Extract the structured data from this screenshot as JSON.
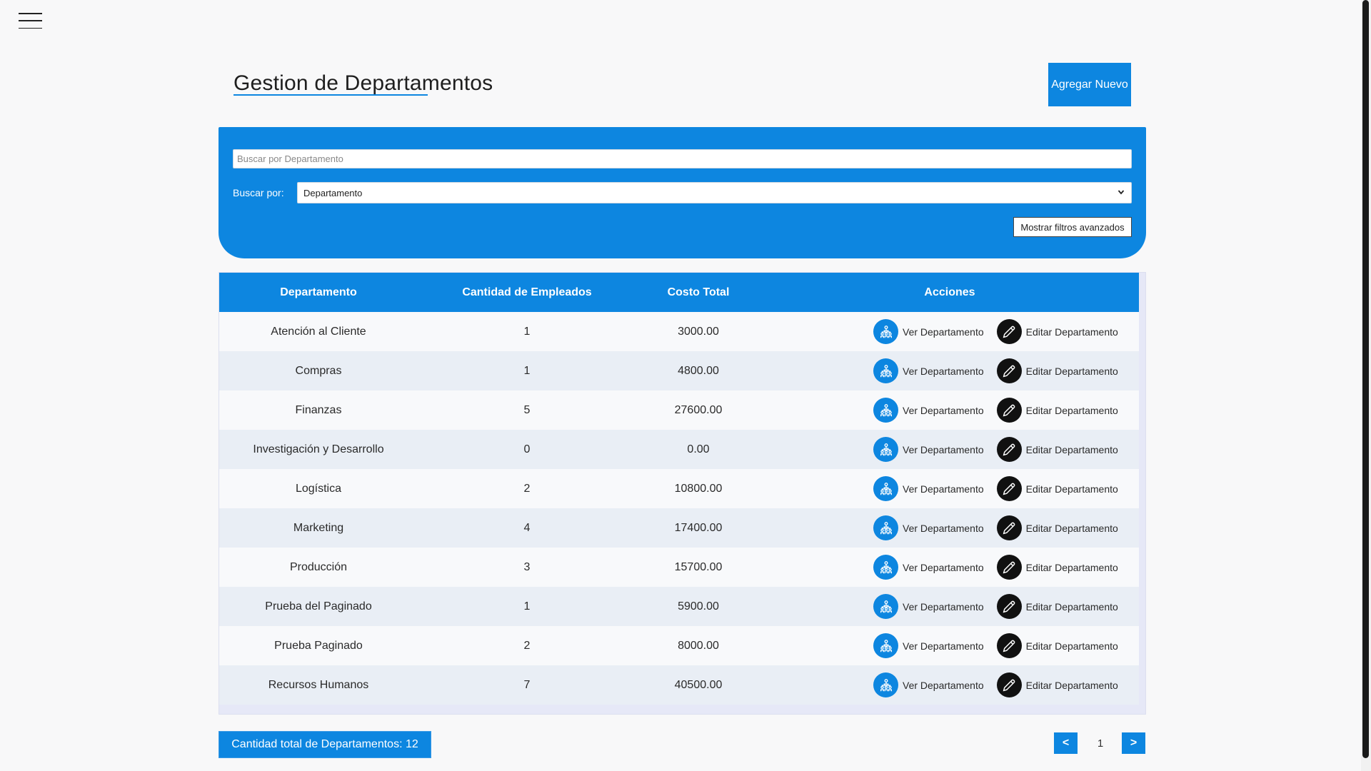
{
  "header": {
    "menu_icon": "hamburger-menu-icon",
    "title": "Gestion de Departamentos",
    "add_button": "Agregar Nuevo"
  },
  "search": {
    "placeholder": "Buscar por Departamento",
    "value": "",
    "search_by_label": "Buscar por:",
    "search_by_selected": "Departamento",
    "advanced_filters_button": "Mostrar filtros avanzados"
  },
  "table": {
    "columns": [
      "Departamento",
      "Cantidad de Empleados",
      "Costo Total",
      "Acciones"
    ],
    "view_label": "Ver Departamento",
    "edit_label": "Editar Departamento",
    "view_icon": "org-chart-icon",
    "edit_icon": "pencil-icon",
    "rows": [
      {
        "department": "Atención al Cliente",
        "employees": "1",
        "cost": "3000.00"
      },
      {
        "department": "Compras",
        "employees": "1",
        "cost": "4800.00"
      },
      {
        "department": "Finanzas",
        "employees": "5",
        "cost": "27600.00"
      },
      {
        "department": "Investigación y Desarrollo",
        "employees": "0",
        "cost": "0.00"
      },
      {
        "department": "Logística",
        "employees": "2",
        "cost": "10800.00"
      },
      {
        "department": "Marketing",
        "employees": "4",
        "cost": "17400.00"
      },
      {
        "department": "Producción",
        "employees": "3",
        "cost": "15700.00"
      },
      {
        "department": "Prueba del Paginado",
        "employees": "1",
        "cost": "5900.00"
      },
      {
        "department": "Prueba Paginado",
        "employees": "2",
        "cost": "8000.00"
      },
      {
        "department": "Recursos Humanos",
        "employees": "7",
        "cost": "40500.00"
      }
    ]
  },
  "footer": {
    "total_label": "Cantidad total de Departamentos: 12",
    "prev_button": "<",
    "page": "1",
    "next_button": ">"
  },
  "colors": {
    "accent": "#0d86e0",
    "row_alt": "#e9eef5",
    "edit_icon_bg": "#111111"
  }
}
